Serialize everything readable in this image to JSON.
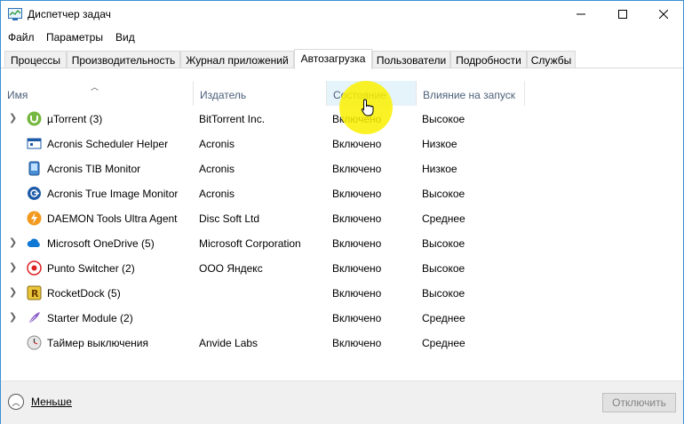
{
  "window": {
    "title": "Диспетчер задач",
    "controls": {
      "minimize": "—",
      "maximize": "☐",
      "close": "✕"
    }
  },
  "menu": [
    "Файл",
    "Параметры",
    "Вид"
  ],
  "tabs": [
    {
      "label": "Процессы",
      "active": false
    },
    {
      "label": "Производительность",
      "active": false
    },
    {
      "label": "Журнал приложений",
      "active": false
    },
    {
      "label": "Автозагрузка",
      "active": true
    },
    {
      "label": "Пользователи",
      "active": false
    },
    {
      "label": "Подробности",
      "active": false
    },
    {
      "label": "Службы",
      "active": false
    }
  ],
  "columns": {
    "name": "Имя",
    "publisher": "Издатель",
    "status": "Состояние",
    "impact": "Влияние на запуск"
  },
  "rows": [
    {
      "name": "µTorrent (3)",
      "publisher": "BitTorrent Inc.",
      "status": "Включено",
      "impact": "Высокое",
      "expandable": true,
      "icon": "utorrent-icon"
    },
    {
      "name": "Acronis Scheduler Helper",
      "publisher": "Acronis",
      "status": "Включено",
      "impact": "Низкое",
      "expandable": false,
      "icon": "acronis-scheduler-icon"
    },
    {
      "name": "Acronis TIB Monitor",
      "publisher": "Acronis",
      "status": "Включено",
      "impact": "Низкое",
      "expandable": false,
      "icon": "acronis-tib-icon"
    },
    {
      "name": "Acronis True Image Monitor",
      "publisher": "Acronis",
      "status": "Включено",
      "impact": "Высокое",
      "expandable": false,
      "icon": "acronis-true-image-icon"
    },
    {
      "name": "DAEMON Tools Ultra Agent",
      "publisher": "Disc Soft Ltd",
      "status": "Включено",
      "impact": "Среднее",
      "expandable": false,
      "icon": "daemon-tools-icon"
    },
    {
      "name": "Microsoft OneDrive (5)",
      "publisher": "Microsoft Corporation",
      "status": "Включено",
      "impact": "Высокое",
      "expandable": true,
      "icon": "onedrive-icon"
    },
    {
      "name": "Punto Switcher (2)",
      "publisher": "ООО Яндекс",
      "status": "Включено",
      "impact": "Высокое",
      "expandable": true,
      "icon": "punto-switcher-icon"
    },
    {
      "name": "RocketDock (5)",
      "publisher": "",
      "status": "Включено",
      "impact": "Высокое",
      "expandable": true,
      "icon": "rocketdock-icon"
    },
    {
      "name": "Starter Module (2)",
      "publisher": "",
      "status": "Включено",
      "impact": "Среднее",
      "expandable": true,
      "icon": "starter-module-icon"
    },
    {
      "name": "Таймер выключения",
      "publisher": "Anvide Labs",
      "status": "Включено",
      "impact": "Среднее",
      "expandable": false,
      "icon": "shutdown-timer-icon"
    }
  ],
  "footer": {
    "less_label": "Меньше",
    "disable_label": "Отключить"
  },
  "colors": {
    "header_text": "#4c607a",
    "hot_column": "#e5f3fb",
    "cursor_highlight": "#faf000"
  }
}
